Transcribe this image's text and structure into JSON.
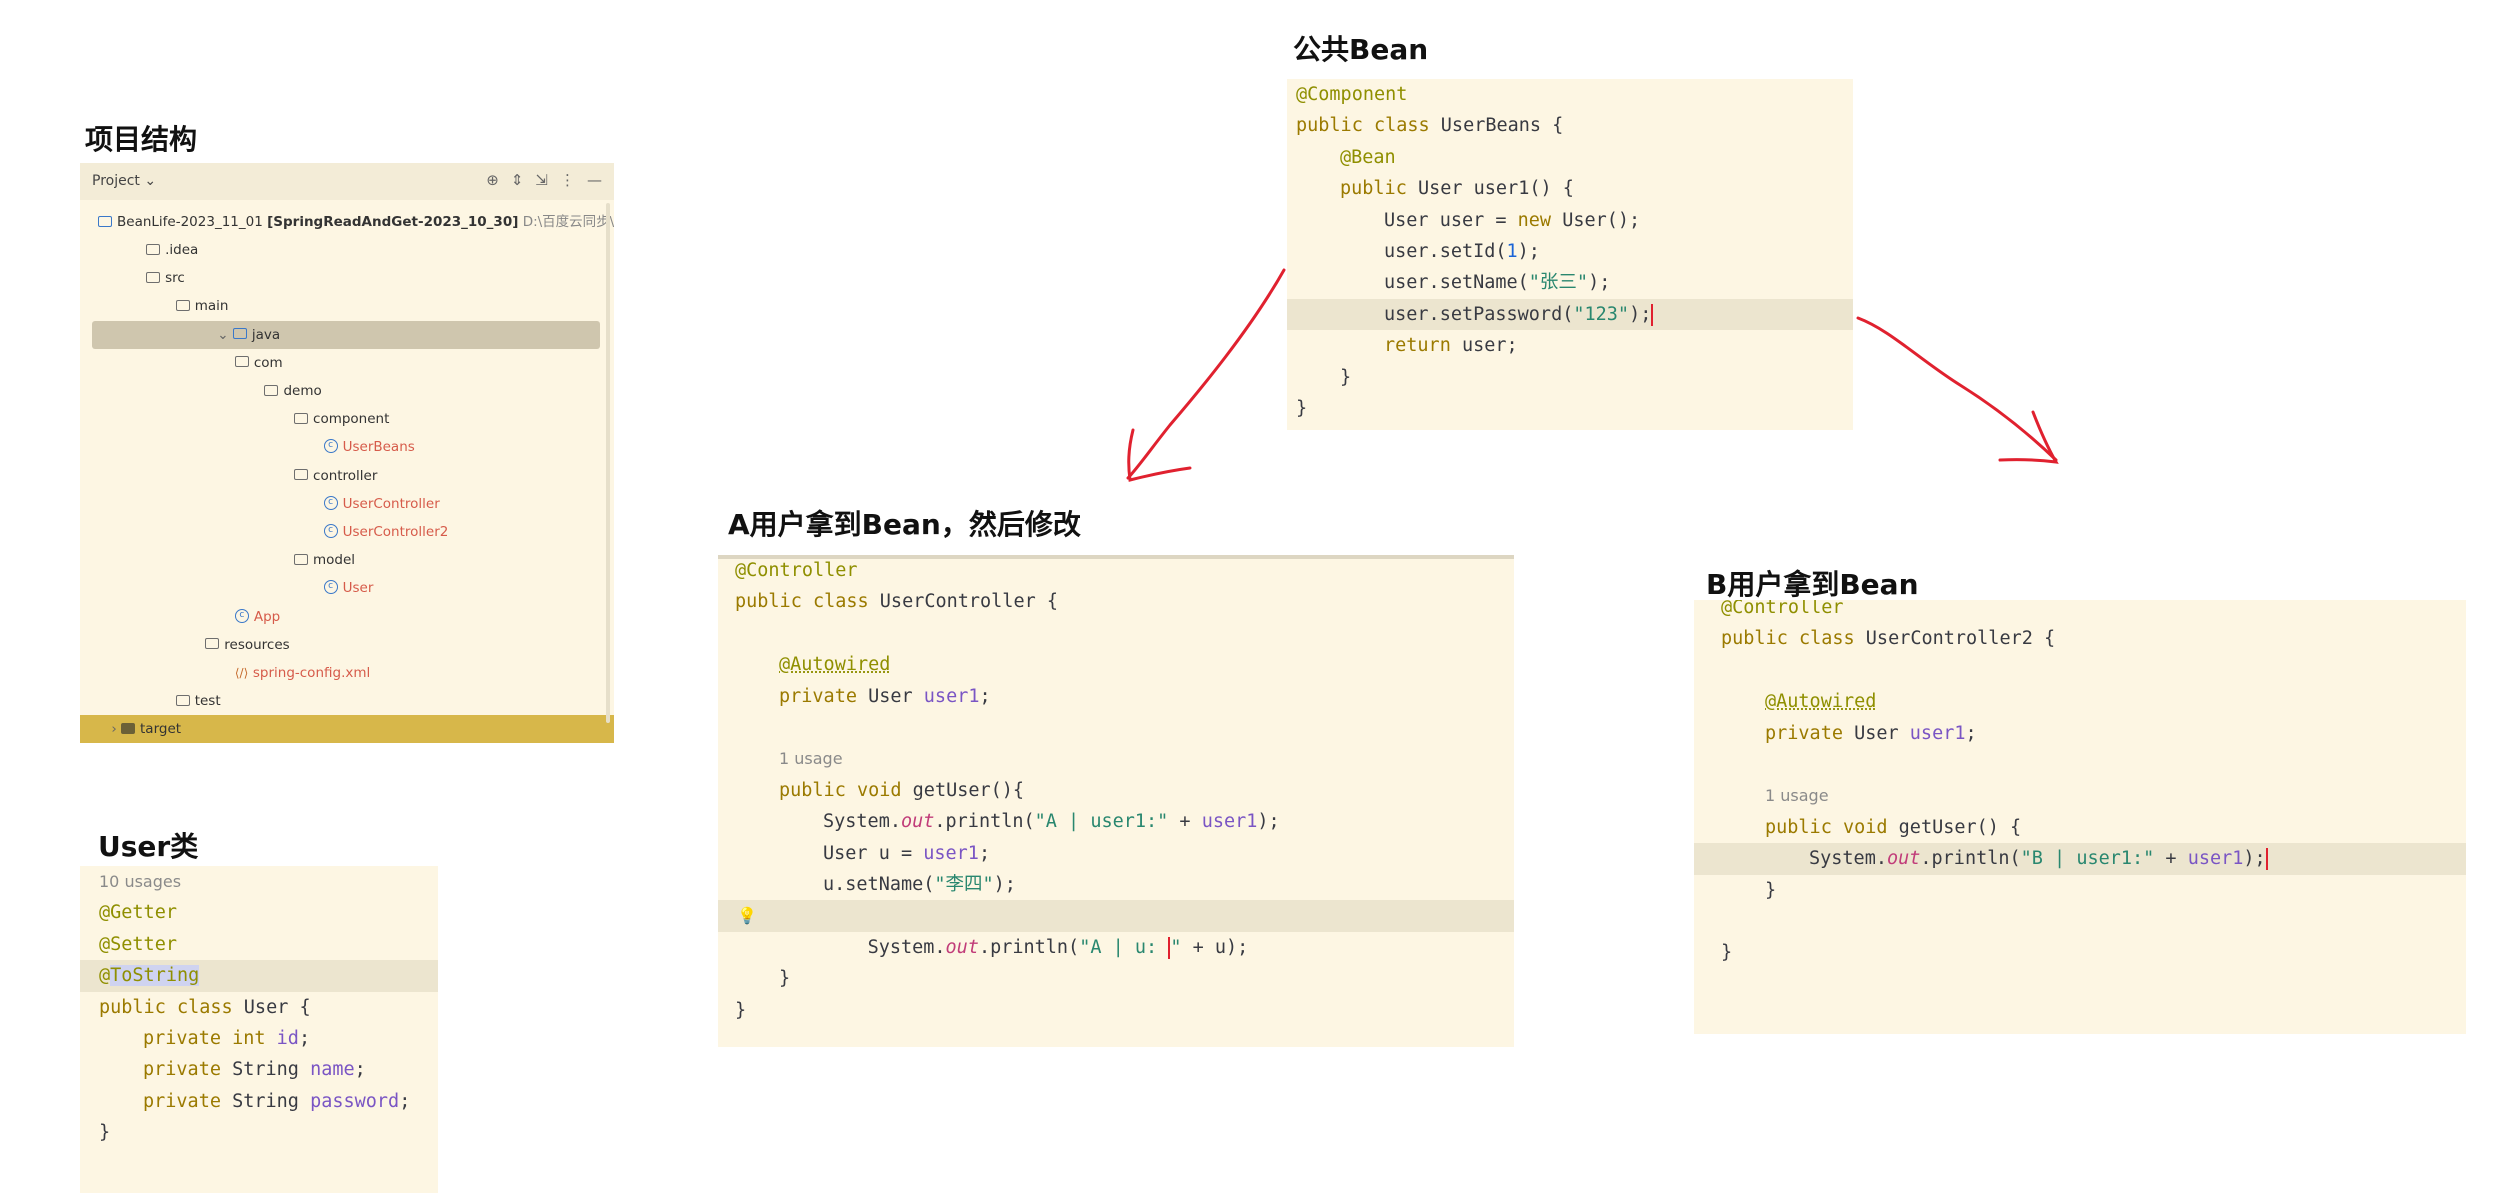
{
  "headings": {
    "project": "项目结构",
    "user_class": "User类",
    "shared_bean": "公共Bean",
    "user_a": "A用户拿到Bean，然后修改",
    "user_b": "B用户拿到Bean"
  },
  "project_tree": {
    "header_title": "Project ⌄",
    "header_icons": [
      "⊕",
      "⇕",
      "⇲",
      "⋮",
      "—"
    ],
    "root_name": "BeanLife-2023_11_01",
    "root_module": "[SpringReadAndGet-2023_10_30]",
    "root_path": "D:\\百度云同步\\BaiduSy",
    "items": [
      {
        "label": ".idea",
        "kind": "folder"
      },
      {
        "label": "src",
        "kind": "folder"
      },
      {
        "label": "main",
        "kind": "folder"
      },
      {
        "label": "java",
        "kind": "folder-blue"
      },
      {
        "label": "com",
        "kind": "package"
      },
      {
        "label": "demo",
        "kind": "package"
      },
      {
        "label": "component",
        "kind": "package"
      },
      {
        "label": "UserBeans",
        "kind": "class"
      },
      {
        "label": "controller",
        "kind": "package"
      },
      {
        "label": "UserController",
        "kind": "class"
      },
      {
        "label": "UserController2",
        "kind": "class"
      },
      {
        "label": "model",
        "kind": "package"
      },
      {
        "label": "User",
        "kind": "class"
      },
      {
        "label": "App",
        "kind": "class"
      },
      {
        "label": "resources",
        "kind": "folder"
      },
      {
        "label": "spring-config.xml",
        "kind": "xml"
      },
      {
        "label": "test",
        "kind": "folder"
      },
      {
        "label": "target",
        "kind": "folder-dark"
      }
    ]
  },
  "user_code": {
    "usages": "10 usages",
    "getter": "@Getter",
    "setter": "@Setter",
    "at": "@",
    "tostring": "ToString",
    "class_kw": "public class",
    "class_name": " User {",
    "fields": [
      {
        "mod": "private",
        "type": "int",
        "name": "id"
      },
      {
        "mod": "private",
        "type": "String",
        "name": "name"
      },
      {
        "mod": "private",
        "type": "String",
        "name": "password"
      }
    ],
    "close": "}",
    "semi": ";"
  },
  "beans_code": {
    "ann_component": "@Component",
    "class_kw": "public class",
    "class_name": " UserBeans {",
    "ann_bean": "@Bean",
    "method_kw": "public",
    "method_sig": " User user1() {",
    "new_line_a": "User user = ",
    "new_kw": "new",
    "new_line_b": " User();",
    "setid_a": "user.setId(",
    "setid_num": "1",
    "setid_b": ");",
    "setname_a": "user.setName(",
    "setname_str": "\"张三\"",
    "setname_b": ");",
    "setpw_a": "user.setPassword(",
    "setpw_str": "\"123\"",
    "setpw_b": ");",
    "return_kw": "return",
    "return_b": " user;",
    "close_inner": "}",
    "close_outer": "}"
  },
  "controller_a": {
    "ann_controller": "@Controller",
    "class_kw": "public class",
    "class_name": " UserController {",
    "ann_autowired": "@Autowired",
    "field_kw": "private",
    "field_type": " User ",
    "field_name": "user1",
    "semi": ";",
    "usage": "1 usage",
    "method_kw": "public void",
    "method_sig": " getUser(){",
    "print_a": "System.",
    "out": "out",
    "print_b": ".println(",
    "print_str1": "\"A | user1:\"",
    "print_c": " + ",
    "print_d": ");",
    "assign_a": "User u = ",
    "assign_b": ";",
    "setname_a": "u.setName(",
    "setname_str": "\"李四\"",
    "setname_b": ");",
    "print_str2a": "\"A | u: ",
    "print_str2b": "\"",
    "print2_c": " + u);",
    "close_inner": "}",
    "close_outer": "}"
  },
  "controller_b": {
    "ann_controller": "@Controller",
    "class_kw": "public class",
    "class_name": " UserController2 {",
    "ann_autowired": "@Autowired",
    "field_kw": "private",
    "field_type": " User ",
    "field_name": "user1",
    "semi": ";",
    "usage": "1 usage",
    "method_kw": "public void",
    "method_sig": " getUser() {",
    "print_a": "System.",
    "out": "out",
    "print_b": ".println(",
    "print_str": "\"B | user1:\"",
    "print_c": " + ",
    "print_d": ");",
    "close_inner": "}",
    "close_outer": "}"
  },
  "colors": {
    "code_bg": "#fdf6e3",
    "highlight_line": "#ece5cf",
    "arrow": "#e0212f",
    "keyword": "#9b7a00",
    "string": "#29876f",
    "field": "#7a55c4"
  }
}
